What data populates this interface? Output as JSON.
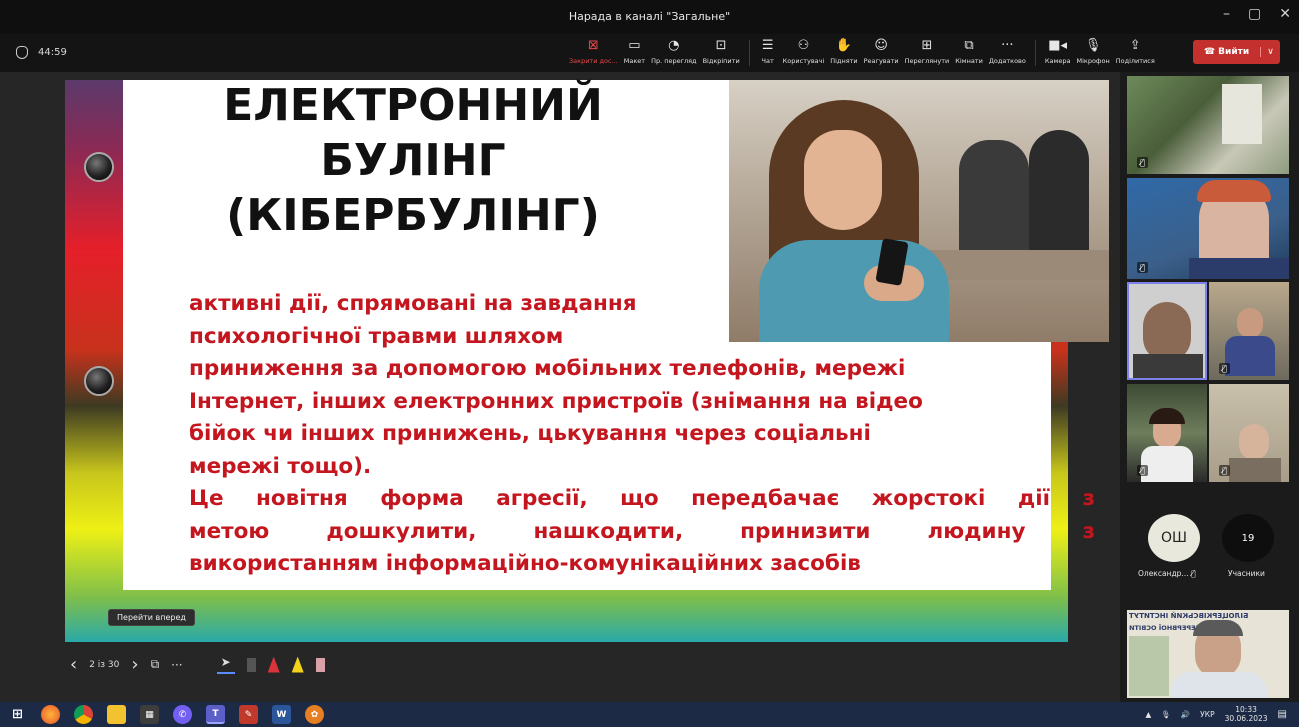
{
  "window": {
    "title": "Нарада в каналі \"Загальне\"",
    "controls": [
      "–",
      "▢",
      "✕"
    ]
  },
  "toolbar": {
    "timer": "44:59",
    "items": [
      {
        "name": "stop-sharing",
        "icon": "⊠",
        "label": "Закрити дос...",
        "red": true
      },
      {
        "name": "layout",
        "icon": "▭",
        "label": "Макет"
      },
      {
        "name": "preview",
        "icon": "◔",
        "label": "Пр. перегляд"
      },
      {
        "name": "pin",
        "icon": "⊡",
        "label": "Відкріпити"
      }
    ],
    "items2": [
      {
        "name": "chat",
        "icon": "☰",
        "label": "Чат"
      },
      {
        "name": "users",
        "icon": "⚇",
        "label": "Користувачі"
      },
      {
        "name": "raise-hand",
        "icon": "✋",
        "label": "Підняти"
      },
      {
        "name": "react",
        "icon": "☺",
        "label": "Реагувати"
      },
      {
        "name": "view",
        "icon": "⊞",
        "label": "Переглянути"
      },
      {
        "name": "rooms",
        "icon": "⧉",
        "label": "Кімнати"
      },
      {
        "name": "more",
        "icon": "···",
        "label": "Додатково"
      }
    ],
    "items3": [
      {
        "name": "camera",
        "icon": "■◂",
        "label": "Камера"
      },
      {
        "name": "mic",
        "icon": "🎙",
        "label": "Мікрофон"
      },
      {
        "name": "share",
        "icon": "⇪",
        "label": "Поділитися"
      }
    ],
    "leave_label": "Вийти",
    "leave_caret": "∨"
  },
  "slide": {
    "title_lines": [
      "ЕЛЕКТРОННИЙ",
      "БУЛІНГ",
      "(КІБЕРБУЛІНГ)"
    ],
    "body_lines": [
      "активні дії, спрямовані на завдання",
      "психологічної травми шляхом",
      "приниження за допомогою мобільних телефонів, мережі",
      "Інтернет, інших електронних пристроїв (знімання на відео",
      "бійок чи інших принижень, цькування через соціальні",
      "мережі тощо).",
      "Це новітня форма агресії, що передбачає жорстокі дії з",
      "метою дошкулити, нашкодити, принизити людину з",
      "використанням інформаційно-комунікаційних засобів"
    ]
  },
  "presenter": {
    "prev": "‹",
    "counter": "2 із 30",
    "next": "›",
    "more": "···",
    "tooltip": "Перейти вперед"
  },
  "participants": {
    "avatar_initials": "ОШ",
    "avatar_name": "Олександр...",
    "count": "19",
    "count_label": "Учасники",
    "banner_text_1": "БІЛОЦЕРКІВСЬКИЙ ІНСТИТУТ",
    "banner_text_2": "НЕПЕРЕРВНОЇ ОСВІТИ"
  },
  "taskbar": {
    "lang": "УКР",
    "time": "10:33",
    "date": "30.06.2023"
  }
}
